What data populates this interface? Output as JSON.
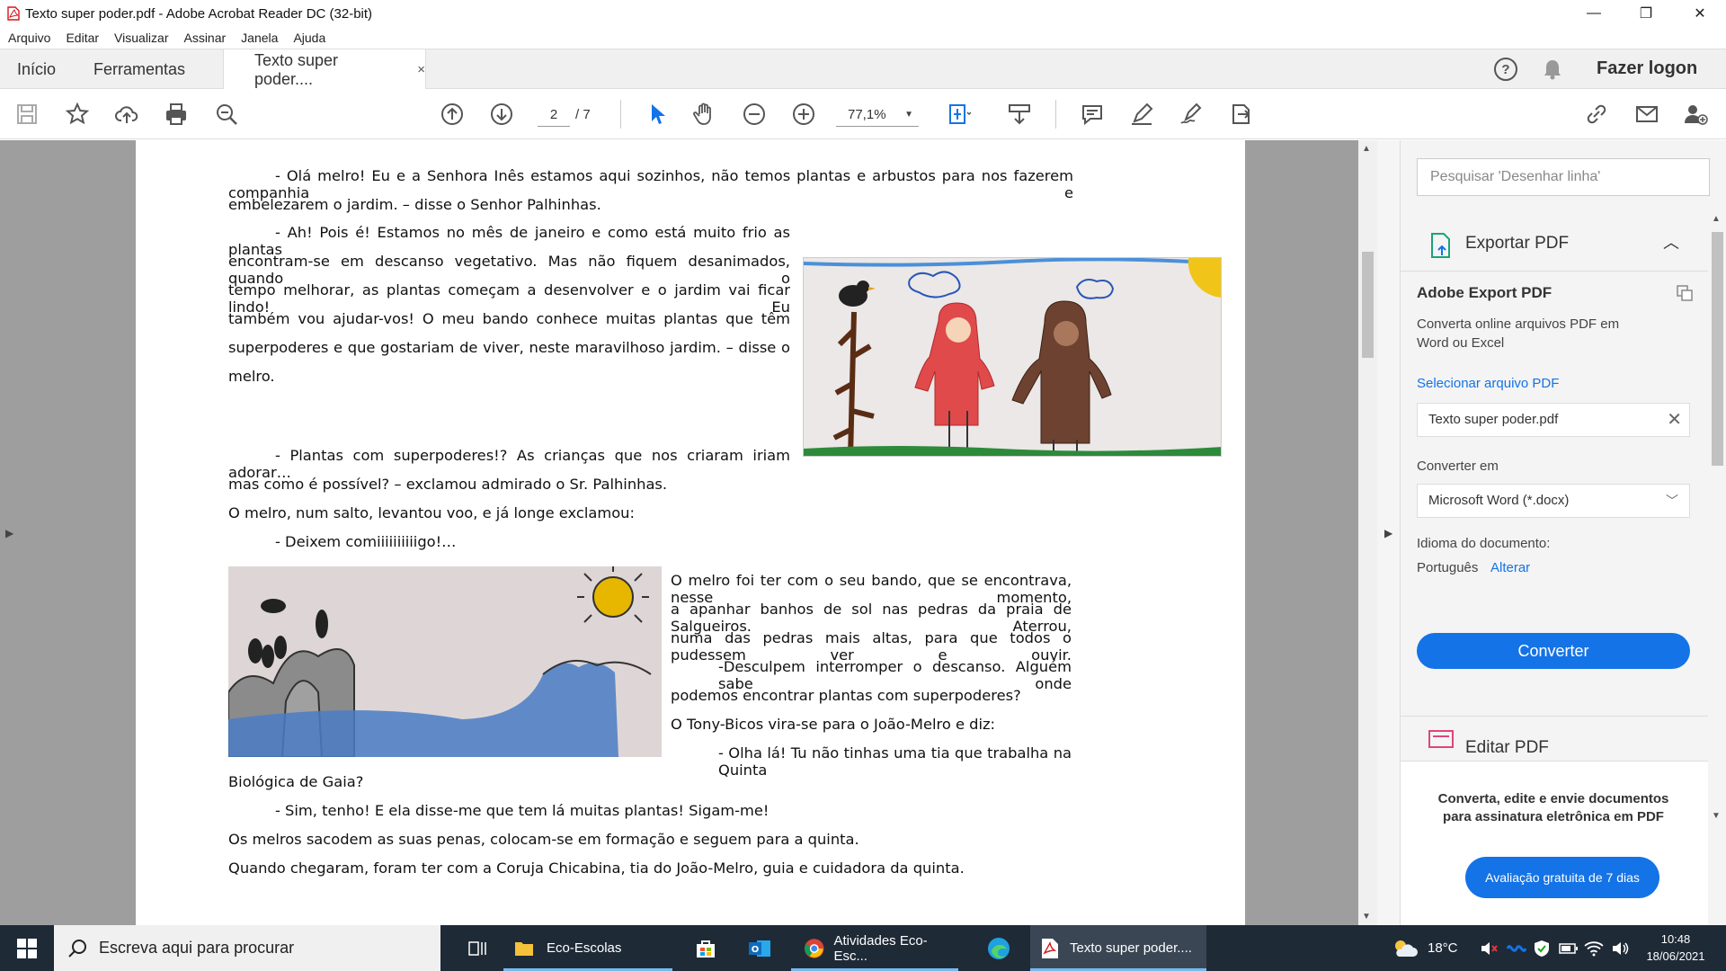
{
  "window": {
    "title": "Texto super poder.pdf - Adobe Acrobat Reader DC (32-bit)"
  },
  "menu": [
    "Arquivo",
    "Editar",
    "Visualizar",
    "Assinar",
    "Janela",
    "Ajuda"
  ],
  "tabs": {
    "home": "Início",
    "tools": "Ferramentas",
    "document": "Texto super poder....",
    "close": "×",
    "login": "Fazer logon"
  },
  "toolbar": {
    "page_current": "2",
    "page_total": "/ 7",
    "zoom": "77,1%"
  },
  "document": {
    "paragraphs": [
      "- Olá melro! Eu e a Senhora Inês estamos aqui sozinhos, não temos plantas e arbustos para nos fazerem companhia e",
      "embelezarem o jardim. – disse o Senhor Palhinhas.",
      "- Ah! Pois é! Estamos no mês de janeiro e como está muito frio as plantas",
      "encontram-se em descanso vegetativo. Mas não fiquem desanimados, quando o",
      "tempo melhorar, as plantas começam a desenvolver e o jardim vai ficar lindo! Eu",
      "também vou ajudar-vos! O meu bando conhece muitas plantas que têm",
      "superpoderes e que gostariam de viver, neste maravilhoso jardim. – disse o",
      "melro.",
      "- Plantas com superpoderes!? As crianças que nos criaram iriam adorar…",
      "mas como é possível? – exclamou admirado o Sr. Palhinhas.",
      "O melro, num salto, levantou voo, e já longe exclamou:",
      "- Deixem comiiiiiiiiiigo!…",
      "O melro foi ter com o seu bando, que se encontrava, nesse momento,",
      "a apanhar banhos de sol nas pedras da praia de Salgueiros. Aterrou,",
      "numa das pedras mais altas, para que todos o pudessem ver e ouvir.",
      "-Desculpem interromper o descanso. Alguém sabe onde",
      "podemos encontrar plantas com superpoderes?",
      "O Tony-Bicos vira-se para o João-Melro e diz:",
      "- Olha lá! Tu não tinhas uma tia que trabalha na Quinta",
      "Biológica de Gaia?",
      "- Sim, tenho! E ela disse-me que tem lá muitas plantas! Sigam-me!",
      "Os melros sacodem as suas penas, colocam-se em formação e seguem para a quinta.",
      "Quando chegaram, foram ter com a Coruja Chicabina, tia do João-Melro, guia e cuidadora da quinta."
    ]
  },
  "right_panel": {
    "search_placeholder": "Pesquisar 'Desenhar linha'",
    "section_title": "Exportar PDF",
    "export_title": "Adobe Export PDF",
    "export_desc_1": "Converta online arquivos PDF em",
    "export_desc_2": "Word ou Excel",
    "select_file": "Selecionar arquivo PDF",
    "file_name": "Texto super poder.pdf",
    "convert_to_label": "Converter em",
    "convert_to_value": "Microsoft Word (*.docx)",
    "doc_language_label": "Idioma do documento:",
    "doc_language_value": "Português",
    "change_link": "Alterar",
    "convert_button": "Converter",
    "next_section": "Editar PDF",
    "promo": "Converta, edite e envie documentos para assinatura eletrônica em PDF",
    "trial_button": "Avaliação gratuita de 7 dias"
  },
  "taskbar": {
    "search_placeholder": "Escreva aqui para procurar",
    "apps": [
      "Eco-Escolas",
      "Atividades Eco-Esc...",
      "Texto super poder...."
    ],
    "temperature": "18°C",
    "time": "10:48",
    "date": "18/06/2021"
  },
  "colors": {
    "accent": "#1473e6",
    "taskbar": "#1f2a37",
    "doc_background": "#9e9e9e"
  }
}
